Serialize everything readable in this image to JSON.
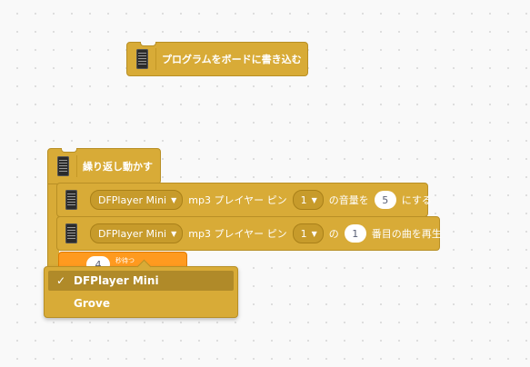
{
  "upload_block": {
    "label": "プログラムをボードに書き込む",
    "icon": "board-icon"
  },
  "loop_block": {
    "label": "繰り返し動かす",
    "icon": "board-icon"
  },
  "volume_block": {
    "device": "DFPlayer Mini",
    "label_prefix": "mp3 プレイヤー ピン",
    "pin": "1",
    "label_mid": "の音量を",
    "volume": "5",
    "label_suffix": "にする"
  },
  "play_block": {
    "device": "DFPlayer Mini",
    "label_prefix": "mp3 プレイヤー ピン",
    "pin": "1",
    "label_mid": "の",
    "track": "1",
    "label_suffix": "番目の曲を再生"
  },
  "hidden_block": {
    "value": "4",
    "small_text": "秒待つ"
  },
  "dropdown_menu": {
    "items": [
      {
        "label": "DFPlayer Mini",
        "selected": true,
        "check": "✓"
      },
      {
        "label": "Grove",
        "selected": false,
        "check": ""
      }
    ]
  },
  "colors": {
    "block": "#d8ab37",
    "block_border": "#b88f25",
    "menu_selected": "#b08a29",
    "control_block": "#ff9a1f",
    "workspace_bg": "#f9f9f9"
  }
}
